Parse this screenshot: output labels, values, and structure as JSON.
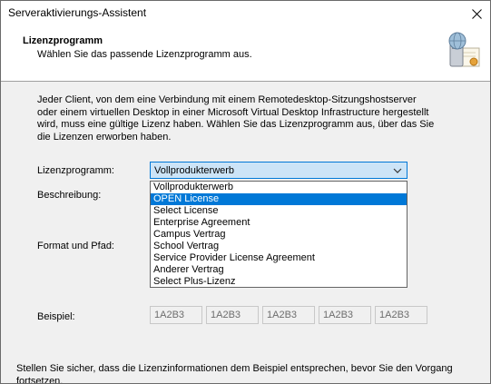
{
  "window": {
    "title": "Serveraktivierungs-Assistent",
    "close_icon": "close-icon"
  },
  "header": {
    "title": "Lizenzprogramm",
    "subtitle": "Wählen Sie das passende Lizenzprogramm aus.",
    "icon": "license-server-certificate-icon"
  },
  "content": {
    "intro": "Jeder Client, von dem eine Verbindung mit einem Remotedesktop-Sitzungshostserver oder einem virtuellen Desktop in einer Microsoft Virtual Desktop Infrastructure hergestellt wird, muss eine gültige Lizenz haben. Wählen Sie das Lizenzprogramm aus, über das Sie die Lizenzen erworben haben.",
    "license_program_label": "Lizenzprogramm:",
    "license_program_value": "Vollprodukterwerb",
    "description_label": "Beschreibung:",
    "format_label": "Format und Pfad:",
    "example_label": "Beispiel:",
    "dropdown_options": [
      "Vollprodukterwerb",
      "OPEN License",
      "Select License",
      "Enterprise Agreement",
      "Campus Vertrag",
      "School Vertrag",
      "Service Provider License Agreement",
      "Anderer Vertrag",
      "Select Plus-Lizenz"
    ],
    "highlighted_option": "OPEN License",
    "example_values": [
      "1A2B3",
      "1A2B3",
      "1A2B3",
      "1A2B3",
      "1A2B3"
    ],
    "footer_note": "Stellen Sie sicher, dass die Lizenzinformationen dem Beispiel entsprechen, bevor Sie den Vorgang fortsetzen."
  },
  "colors": {
    "accent": "#0078d7",
    "combo_bg": "#cce4f7",
    "window_bg": "#f0f0f0"
  }
}
